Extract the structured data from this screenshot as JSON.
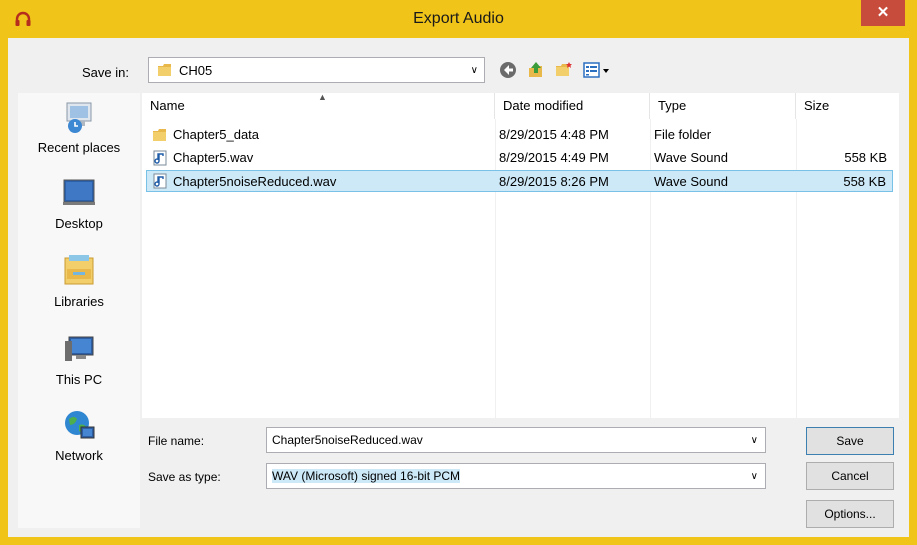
{
  "window": {
    "title": "Export Audio",
    "close_label": "✕"
  },
  "savein": {
    "label": "Save in:",
    "value": "CH05"
  },
  "places": [
    {
      "label": "Recent places"
    },
    {
      "label": "Desktop"
    },
    {
      "label": "Libraries"
    },
    {
      "label": "This PC"
    },
    {
      "label": "Network"
    }
  ],
  "columns": {
    "name": "Name",
    "date": "Date modified",
    "type": "Type",
    "size": "Size"
  },
  "files": [
    {
      "name": "Chapter5_data",
      "date": "8/29/2015 4:48 PM",
      "type": "File folder",
      "size": "",
      "icon": "folder-icon"
    },
    {
      "name": "Chapter5.wav",
      "date": "8/29/2015 4:49 PM",
      "type": "Wave Sound",
      "size": "558 KB",
      "icon": "audio-file-icon"
    },
    {
      "name": "Chapter5noiseReduced.wav",
      "date": "8/29/2015 8:26 PM",
      "type": "Wave Sound",
      "size": "558 KB",
      "icon": "audio-file-icon",
      "selected": true
    }
  ],
  "filename": {
    "label": "File name:",
    "value": "Chapter5noiseReduced.wav"
  },
  "filetype": {
    "label": "Save as type:",
    "value": "WAV (Microsoft) signed 16-bit PCM"
  },
  "buttons": {
    "save": "Save",
    "cancel": "Cancel",
    "options": "Options..."
  },
  "colors": {
    "titlebar": "#f0c419",
    "close": "#c74c3c",
    "selection": "#cde8f7"
  }
}
